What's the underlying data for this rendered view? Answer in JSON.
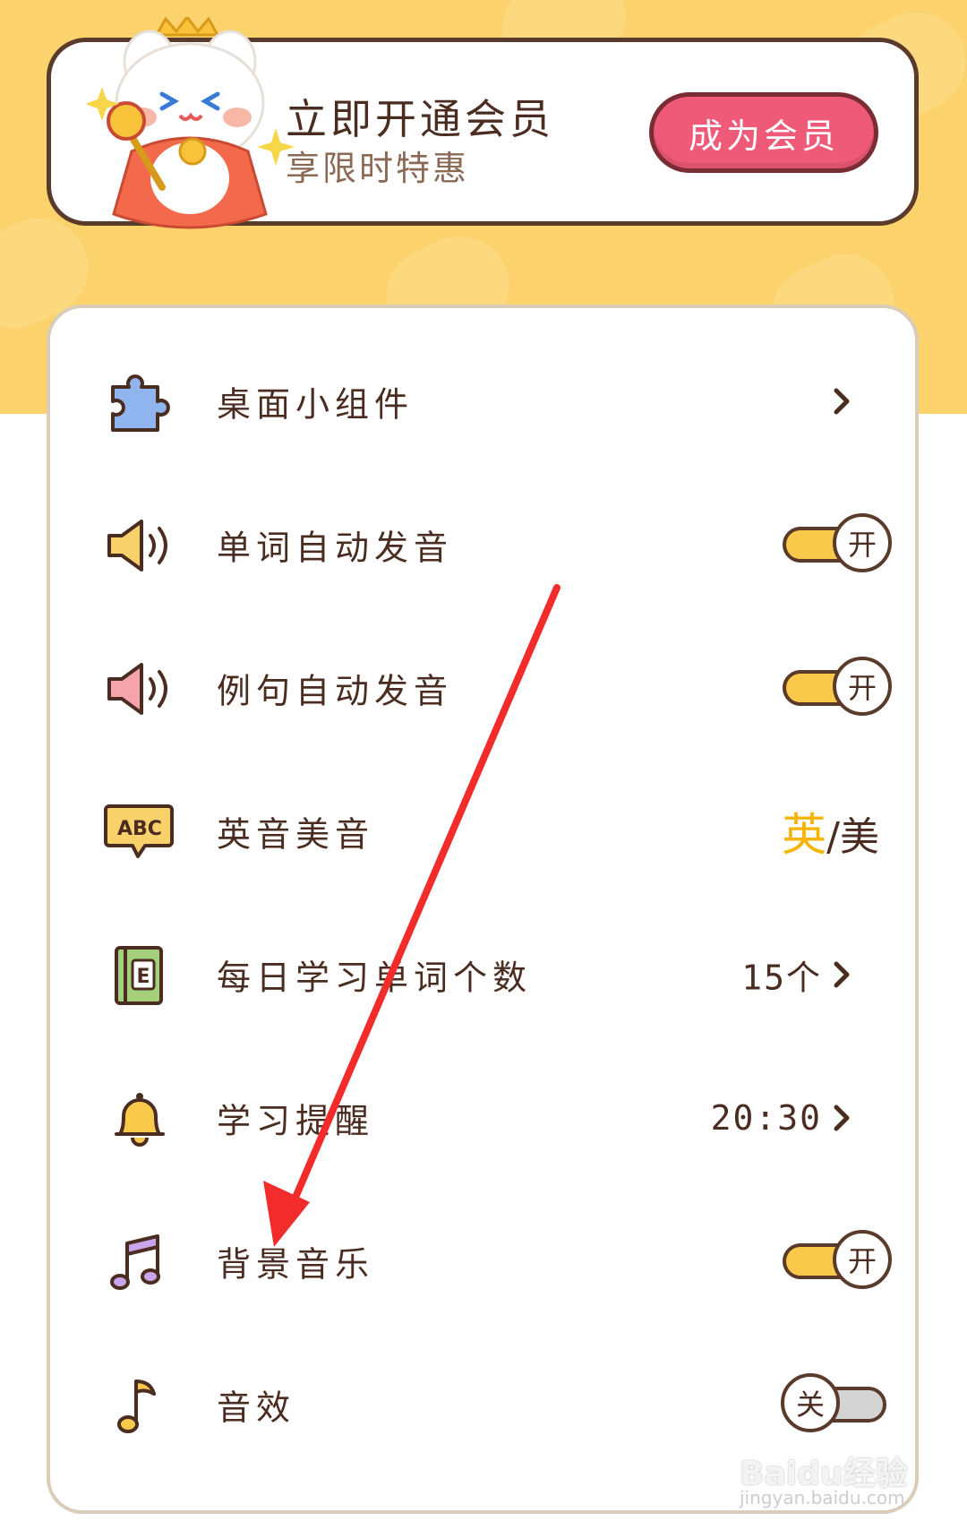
{
  "member_banner": {
    "title": "立即开通会员",
    "subtitle": "享限时特惠",
    "button_label": "成为会员"
  },
  "settings": [
    {
      "label": "桌面小组件",
      "icon": "puzzle-icon",
      "control": "chevron"
    },
    {
      "label": "单词自动发音",
      "icon": "speaker-icon",
      "control": "toggle",
      "state": "开"
    },
    {
      "label": "例句自动发音",
      "icon": "speaker-icon",
      "control": "toggle",
      "state": "开"
    },
    {
      "label": "英音美音",
      "icon": "abc-bubble-icon",
      "control": "accent",
      "value_active": "英",
      "value_separator": "/",
      "value_inactive": "美"
    },
    {
      "label": "每日学习单词个数",
      "icon": "book-icon",
      "control": "value",
      "value": "15个"
    },
    {
      "label": "学习提醒",
      "icon": "bell-icon",
      "control": "value",
      "value": "20:30"
    },
    {
      "label": "背景音乐",
      "icon": "music-notes-icon",
      "control": "toggle",
      "state": "开"
    },
    {
      "label": "音效",
      "icon": "music-note-icon",
      "control": "toggle",
      "state": "关"
    }
  ],
  "watermark": {
    "brand": "Baidu经验",
    "url": "jingyan.baidu.com"
  },
  "colors": {
    "header_yellow": "#fbd26b",
    "toggle_on": "#f9c94b",
    "toggle_off": "#d4d4d4",
    "button_pink": "#ee5a78",
    "outline_brown": "#5a3a2b",
    "annotation_red": "#f22b2b"
  }
}
